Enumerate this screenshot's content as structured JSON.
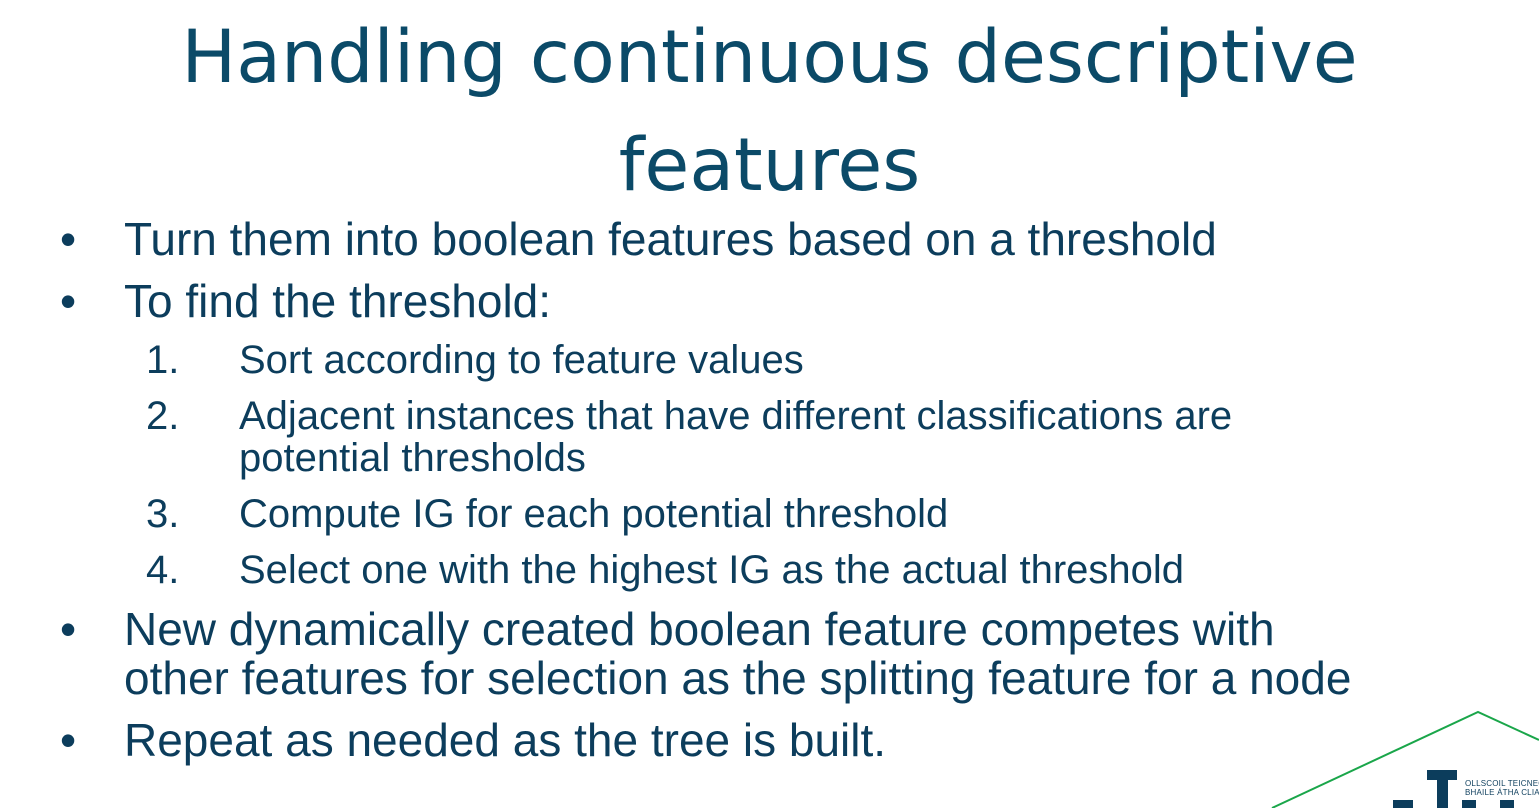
{
  "slide": {
    "title_line1": "Handling continuous descriptive",
    "title_line2": "features",
    "bullets": [
      {
        "marker": "•",
        "text": "Turn them into boolean features based on a threshold"
      },
      {
        "marker": "•",
        "text": "To find the threshold:"
      },
      {
        "marker": "•",
        "text_line1": "New dynamically created boolean feature competes with",
        "text_line2": "other features for selection as the splitting feature for a node"
      },
      {
        "marker": "•",
        "text": "Repeat as needed as the tree is built."
      }
    ],
    "steps": [
      {
        "number": "1.",
        "text": "Sort according to feature values"
      },
      {
        "number": "2.",
        "text_line1": "Adjacent instances that have different classifications are",
        "text_line2": "potential thresholds"
      },
      {
        "number": "3.",
        "text": "Compute IG for each potential threshold"
      },
      {
        "number": "4.",
        "text": "Select one with the highest IG as the actual threshold"
      }
    ]
  },
  "logo": {
    "line1": "OLLSCOIL TEICNEOLAÍ",
    "line2": "BHAILE ÁTHA CLIATH",
    "accent_color": "#1aa64a",
    "text_color": "#0c3d5c"
  },
  "colors": {
    "title": "#0b4a68",
    "body": "#0c3d5c",
    "background": "#ffffff"
  }
}
